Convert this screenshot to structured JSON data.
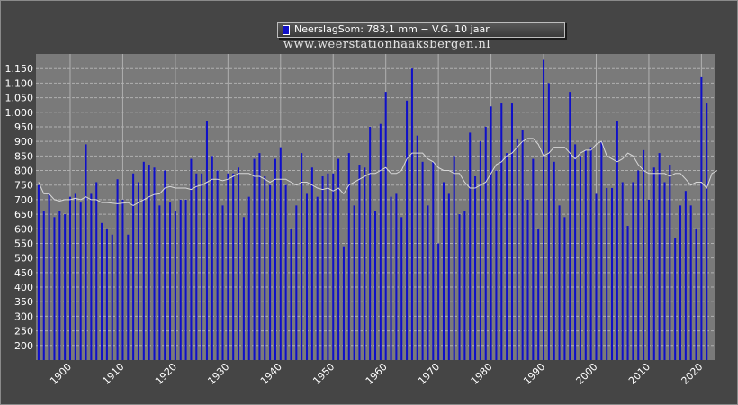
{
  "legend": {
    "label": "NeerslagSom: 783,1 mm − V.G. 10 jaar",
    "bar_color": "#1010c8"
  },
  "watermark": "www.weerstationhaaksbergen.nl",
  "chart_data": {
    "type": "bar",
    "units": "mm",
    "x_start_year": 1894,
    "x_ticks": [
      "1900",
      "1910",
      "1920",
      "1930",
      "1940",
      "1950",
      "1960",
      "1970",
      "1980",
      "1990",
      "2000",
      "2010",
      "2020"
    ],
    "y_ticks": [
      "200",
      "250",
      "300",
      "350",
      "400",
      "450",
      "500",
      "550",
      "600",
      "650",
      "700",
      "750",
      "800",
      "850",
      "900",
      "950",
      "1.000",
      "1.050",
      "1.100",
      "1.150"
    ],
    "ylim": [
      150,
      1200
    ],
    "grid": true,
    "colors": {
      "bars": "#1010c8",
      "moving_average": "#d8d8d8",
      "plot_bg": "#7a7a7a",
      "grid": "#b0b0b0"
    },
    "series": [
      {
        "name": "NeerslagSom",
        "values": [
          750,
          660,
          720,
          640,
          660,
          650,
          710,
          720,
          690,
          890,
          720,
          760,
          620,
          600,
          580,
          770,
          700,
          580,
          790,
          760,
          830,
          820,
          810,
          680,
          800,
          690,
          660,
          700,
          700,
          840,
          790,
          790,
          970,
          850,
          800,
          680,
          790,
          790,
          810,
          640,
          710,
          840,
          860,
          780,
          750,
          840,
          880,
          750,
          600,
          680,
          860,
          720,
          810,
          710,
          780,
          790,
          790,
          840,
          540,
          860,
          680,
          820,
          810,
          950,
          660,
          960,
          1070,
          710,
          720,
          640,
          1040,
          1150,
          920,
          830,
          680,
          830,
          550,
          760,
          720,
          850,
          650,
          660,
          930,
          780,
          900,
          950,
          1020,
          800,
          1030,
          860,
          1030,
          910,
          940,
          700,
          840,
          600,
          1180,
          1100,
          830,
          680,
          640,
          1070,
          890,
          850,
          870,
          880,
          720,
          900,
          740,
          740,
          970,
          760,
          610,
          760,
          800,
          870,
          700,
          810,
          860,
          760,
          820,
          570,
          680,
          730,
          680,
          600,
          1120,
          1030,
          150
        ]
      }
    ],
    "moving_average": {
      "start_index": 0,
      "values": [
        760,
        720,
        720,
        700,
        695,
        700,
        700,
        705,
        700,
        710,
        700,
        700,
        690,
        690,
        688,
        686,
        688,
        690,
        680,
        690,
        700,
        710,
        718,
        720,
        740,
        745,
        740,
        740,
        740,
        735,
        745,
        750,
        760,
        770,
        770,
        765,
        770,
        780,
        790,
        790,
        790,
        780,
        780,
        770,
        760,
        770,
        770,
        770,
        760,
        750,
        760,
        760,
        750,
        740,
        735,
        740,
        730,
        740,
        720,
        750,
        760,
        770,
        780,
        790,
        790,
        800,
        810,
        790,
        790,
        800,
        840,
        860,
        860,
        860,
        840,
        830,
        810,
        800,
        800,
        790,
        790,
        760,
        740,
        740,
        750,
        760,
        790,
        820,
        830,
        850,
        860,
        880,
        900,
        910,
        910,
        890,
        850,
        860,
        880,
        880,
        880,
        860,
        840,
        860,
        870,
        870,
        890,
        900,
        850,
        840,
        830,
        840,
        860,
        850,
        820,
        800,
        790,
        790,
        790,
        790,
        780,
        790,
        790,
        770,
        750,
        760,
        760,
        740,
        790,
        800
      ]
    }
  }
}
